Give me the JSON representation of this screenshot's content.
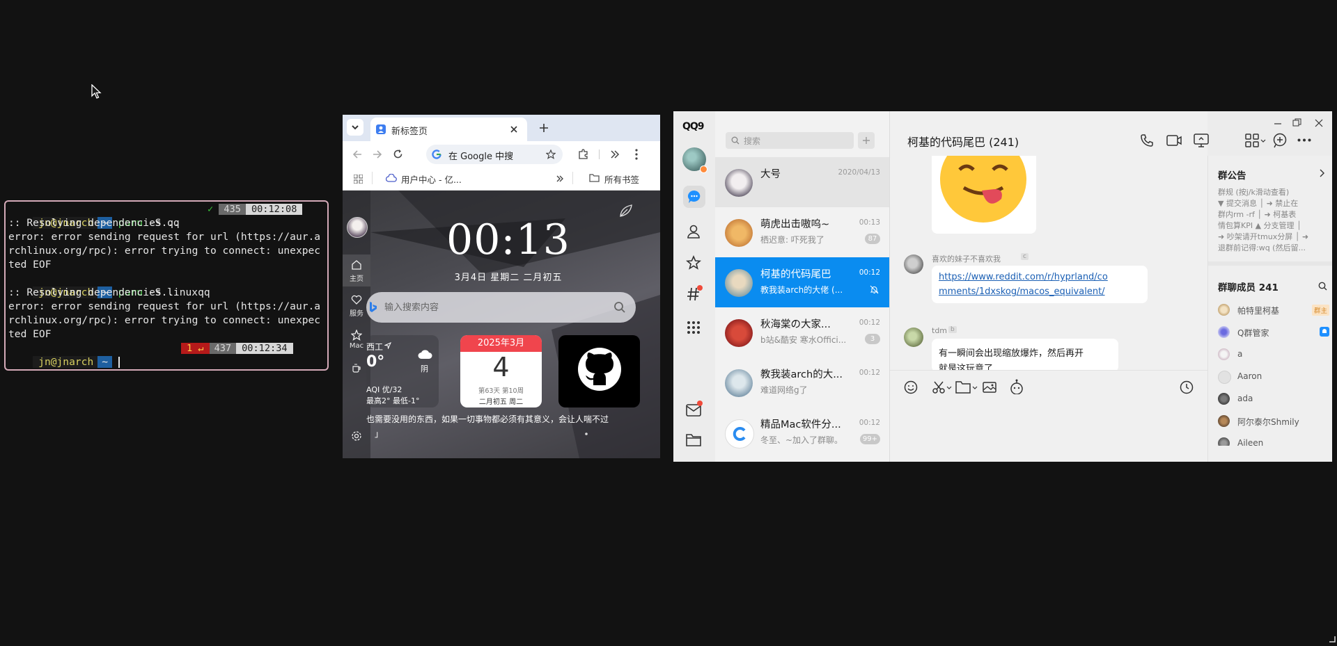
{
  "terminal": {
    "lines": [
      {
        "user": "jn@jnarch",
        "dir": "~",
        "cmd": "paru",
        "args": "-S qq",
        "check": "✓",
        "count": "435",
        "time": "00:12:08"
      },
      {
        "text": ":: Resolving dependencies..."
      },
      {
        "text": "error: error sending request for url (https://aur.a"
      },
      {
        "text": "rchlinux.org/rpc): error trying to connect: unexpec"
      },
      {
        "text": "ted EOF"
      },
      {
        "user": "jn@jnarch",
        "dir": "~",
        "cmd": "paru",
        "args": "-S linuxqq"
      },
      {
        "text": ":: Resolving dependencies..."
      },
      {
        "text": "error: error sending request for url (https://aur.a"
      },
      {
        "text": "rchlinux.org/rpc): error trying to connect: unexpec"
      },
      {
        "text": "ted EOF"
      },
      {
        "user": "jn@jnarch",
        "dir": "~",
        "exit": "1 ↵",
        "count": "437",
        "time": "00:12:34"
      }
    ]
  },
  "browser": {
    "tab_title": "新标签页",
    "omnibox": "在 Google 中搜",
    "bookmark_1": "用户中心 - 亿...",
    "all_bookmarks": "所有书签",
    "clock": "00:13",
    "date_line": "3月4日 星期二 二月初五",
    "search_placeholder": "输入搜索内容",
    "side": {
      "home": "主页",
      "service": "服务",
      "mac": "Mac"
    },
    "weather": {
      "city": "西工",
      "temp": "0°",
      "cond": "阴",
      "aqi": "AQI 优/32",
      "range": "最高2° 最低-1°"
    },
    "calendar": {
      "header": "2025年3月",
      "day": "4",
      "sub1": "第63天 第10周",
      "sub2": "二月初五 周二"
    },
    "quote_1": "也需要没用的东西，如果一切事物都必须有其意义，会让人喘不过",
    "quote_2": "」"
  },
  "qq": {
    "logo": "QQ9",
    "search_placeholder": "搜索",
    "conversations": [
      {
        "name": "大号",
        "preview": "",
        "time": "2020/04/13",
        "badge": ""
      },
      {
        "name": "萌虎出击嗷呜~",
        "preview": "栖迟意: 吓死我了",
        "time": "00:13",
        "badge": "87"
      },
      {
        "name": "柯基的代码尾巴",
        "preview": "教我装arch的大佬 (...",
        "time": "00:12",
        "badge": ""
      },
      {
        "name": "秋海棠の大家...",
        "preview": "b站&酷安 寒水Offici...",
        "time": "00:12",
        "badge": "3"
      },
      {
        "name": "教我装arch的大...",
        "preview": "难道网络g了",
        "time": "00:12",
        "badge": ""
      },
      {
        "name": "精品Mac软件分...",
        "preview": "冬至、~加入了群聊。",
        "time": "00:12",
        "badge": "99+"
      }
    ],
    "chat": {
      "title": "柯基的代码尾巴 (241)",
      "msg1_sender": "喜欢的妹子不喜欢我",
      "msg1_tag": "c",
      "msg1_link_1": "https://www.reddit.com/r/hyprland/co",
      "msg1_link_2": "mments/1dxskog/macos_equivalent/",
      "msg2_sender": "tdm",
      "msg2_tag": "b",
      "msg2_text_1": "有一瞬间会出现缩放爆炸，然后再开",
      "msg2_text_2": "就是这玩意了"
    },
    "announcement": {
      "title": "群公告",
      "lines": [
        "群规 (按j/k滑动查看)",
        "▼ 提交消息 │ ➜ 禁止在",
        "群内rm -rf │ ➜ 柯基表",
        "情包算KPI ▲ 分支管理 │",
        "➜ 吵架请开tmux分屏 │ ➜",
        "退群前记得:wq (然后留..."
      ]
    },
    "members": {
      "title": "群聊成员 241",
      "list": [
        {
          "name": "帕特里柯基",
          "tag": "群主"
        },
        {
          "name": "Q群管家",
          "tag": "bot"
        },
        {
          "name": "a",
          "tag": ""
        },
        {
          "name": "Aaron",
          "tag": ""
        },
        {
          "name": "ada",
          "tag": ""
        },
        {
          "name": "阿尔泰尔Shmily",
          "tag": ""
        },
        {
          "name": "Aileen",
          "tag": ""
        }
      ]
    }
  }
}
